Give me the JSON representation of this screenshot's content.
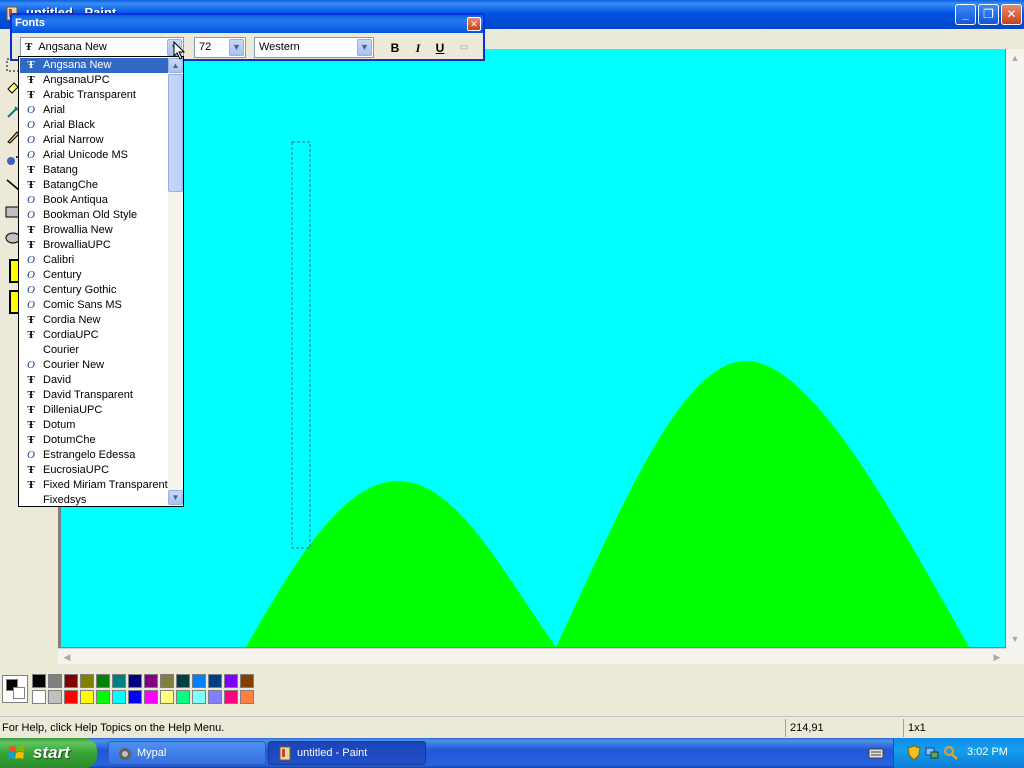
{
  "window": {
    "title": "untitled - Paint"
  },
  "fonts_toolbar": {
    "title": "Fonts",
    "font_value": "Angsana New",
    "size_value": "72",
    "script_value": "Western",
    "bold_label": "B",
    "italic_label": "I",
    "underline_label": "U"
  },
  "font_list": [
    {
      "name": "Angsana New",
      "type": "truetype",
      "selected": true
    },
    {
      "name": "AngsanaUPC",
      "type": "truetype"
    },
    {
      "name": "Arabic Transparent",
      "type": "truetype"
    },
    {
      "name": "Arial",
      "type": "opentype"
    },
    {
      "name": "Arial Black",
      "type": "opentype"
    },
    {
      "name": "Arial Narrow",
      "type": "opentype"
    },
    {
      "name": "Arial Unicode MS",
      "type": "opentype"
    },
    {
      "name": "Batang",
      "type": "truetype"
    },
    {
      "name": "BatangChe",
      "type": "truetype"
    },
    {
      "name": "Book Antiqua",
      "type": "opentype"
    },
    {
      "name": "Bookman Old Style",
      "type": "opentype"
    },
    {
      "name": "Browallia New",
      "type": "truetype"
    },
    {
      "name": "BrowalliaUPC",
      "type": "truetype"
    },
    {
      "name": "Calibri",
      "type": "opentype"
    },
    {
      "name": "Century",
      "type": "opentype"
    },
    {
      "name": "Century Gothic",
      "type": "opentype"
    },
    {
      "name": "Comic Sans MS",
      "type": "opentype"
    },
    {
      "name": "Cordia New",
      "type": "truetype"
    },
    {
      "name": "CordiaUPC",
      "type": "truetype"
    },
    {
      "name": "Courier",
      "type": "none"
    },
    {
      "name": "Courier New",
      "type": "opentype"
    },
    {
      "name": "David",
      "type": "truetype"
    },
    {
      "name": "David Transparent",
      "type": "truetype"
    },
    {
      "name": "DilleniaUPC",
      "type": "truetype"
    },
    {
      "name": "Dotum",
      "type": "truetype"
    },
    {
      "name": "DotumChe",
      "type": "truetype"
    },
    {
      "name": "Estrangelo Edessa",
      "type": "opentype"
    },
    {
      "name": "EucrosiaUPC",
      "type": "truetype"
    },
    {
      "name": "Fixed Miriam Transparent",
      "type": "truetype"
    },
    {
      "name": "Fixedsys",
      "type": "none"
    }
  ],
  "palette": {
    "top_row": [
      "#000000",
      "#808080",
      "#800000",
      "#808000",
      "#008000",
      "#008080",
      "#000080",
      "#800080",
      "#808040",
      "#004040",
      "#0080ff",
      "#004080",
      "#8000ff",
      "#804000"
    ],
    "bottom_row": [
      "#ffffff",
      "#c0c0c0",
      "#ff0000",
      "#ffff00",
      "#00ff00",
      "#00ffff",
      "#0000ff",
      "#ff00ff",
      "#ffff80",
      "#00ff80",
      "#80ffff",
      "#8080ff",
      "#ff0080",
      "#ff8040"
    ],
    "foreground": "#000000",
    "background": "#ffffff"
  },
  "canvas": {
    "sky_color": "#00ffff",
    "hill_color": "#00ff00"
  },
  "status": {
    "help_text": "For Help, click Help Topics on the Help Menu.",
    "coords": "214,91",
    "size": "1x1"
  },
  "taskbar": {
    "start_label": "start",
    "tasks": [
      {
        "label": "Mypal"
      },
      {
        "label": "untitled - Paint"
      }
    ],
    "clock": "3:02 PM"
  },
  "icons": {
    "tt_glyph": "Ŧ",
    "ot_glyph": "O"
  }
}
